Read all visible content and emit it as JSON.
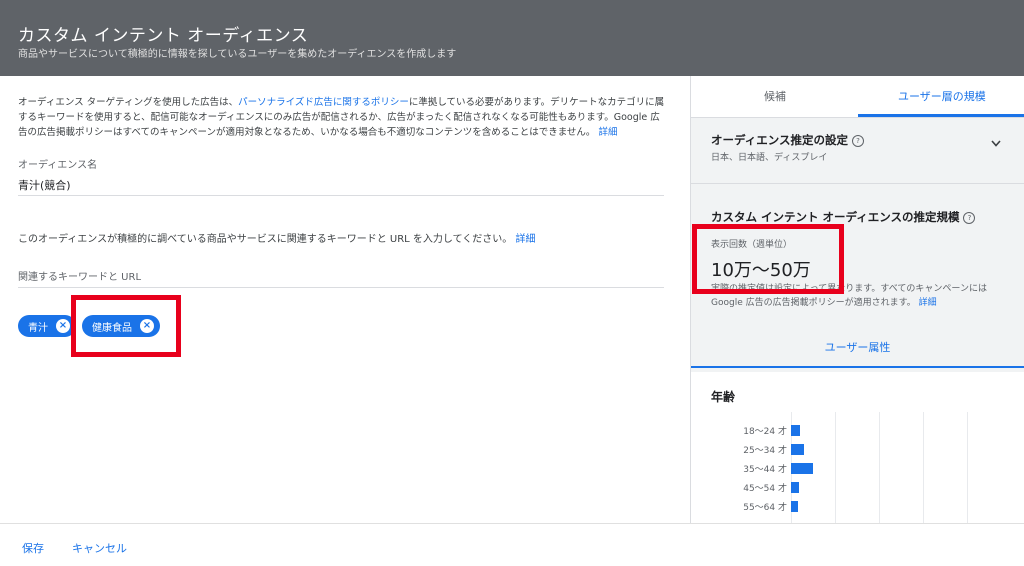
{
  "header": {
    "title": "カスタム インテント オーディエンス",
    "subtitle": "商品やサービスについて積極的に情報を探しているユーザーを集めたオーディエンスを作成します"
  },
  "policy": {
    "part1": "オーディエンス ターゲティングを使用した広告は、",
    "link": "パーソナライズド広告に関するポリシー",
    "part2": "に準拠している必要があります。デリケートなカテゴリに属するキーワードを使用すると、配信可能なオーディエンスにのみ広告が配信されるか、広告がまったく配信されなくなる可能性もあります。Google 広告の広告掲載ポリシーはすべてのキャンペーンが適用対象となるため、いかなる場合も不適切なコンテンツを含めることはできません。",
    "detail": "詳細"
  },
  "audience_name": {
    "label": "オーディエンス名",
    "value": "青汁(競合)"
  },
  "instruction": {
    "text": "このオーディエンスが積極的に調べている商品やサービスに関連するキーワードと URL を入力してください。",
    "detail": "詳細"
  },
  "keywords": {
    "label": "関連するキーワードと URL",
    "chips": [
      "青汁",
      "健康食品"
    ]
  },
  "footer": {
    "save": "保存",
    "cancel": "キャンセル"
  },
  "tabs": [
    {
      "label": "候補"
    },
    {
      "label": "ユーザー層の規模"
    }
  ],
  "estimate_settings": {
    "title": "オーディエンス推定の設定",
    "summary": "日本、日本語、ディスプレイ"
  },
  "estimate": {
    "title": "カスタム インテント オーディエンスの推定規模",
    "impressions_label": "表示回数（週単位）",
    "impressions_value": "10万〜50万",
    "note": "実際の推定値は設定によって異なります。すべてのキャンペーンには Google 広告の広告掲載ポリシーが適用されます。",
    "detail": "詳細",
    "demographics_link": "ユーザー属性"
  },
  "age": {
    "title": "年齢",
    "groups": [
      {
        "label": "18〜24 才",
        "value": 0.15
      },
      {
        "label": "25〜34 才",
        "value": 0.22
      },
      {
        "label": "35〜44 才",
        "value": 0.36
      },
      {
        "label": "45〜54 才",
        "value": 0.14
      },
      {
        "label": "55〜64 才",
        "value": 0.12
      }
    ]
  },
  "colors": {
    "accent": "#1a73e8",
    "highlight": "#e8001c",
    "header": "#5f6368"
  }
}
